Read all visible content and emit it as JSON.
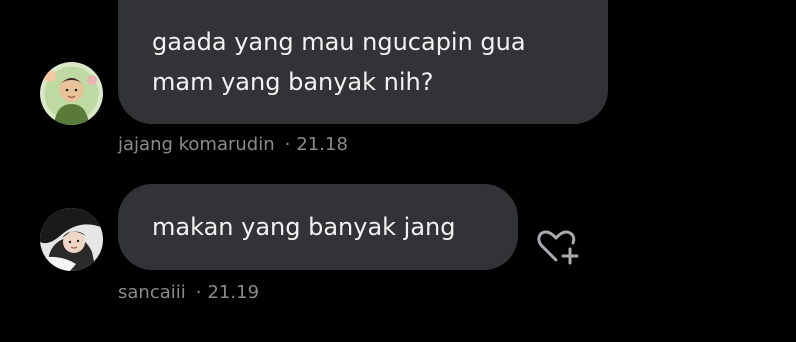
{
  "messages": [
    {
      "lines": [
        "gaada yang mau ngucapin gua",
        "mam yang banyak nih?"
      ],
      "author": "jajang komarudin",
      "time": "21.18",
      "avatar_icon": "profile-photo"
    },
    {
      "lines": [
        "makan yang banyak jang"
      ],
      "author": "sancaiii",
      "time": "21.19",
      "avatar_icon": "profile-photo"
    }
  ],
  "time_separator": "·",
  "like_icon": "heart-plus-icon",
  "colors": {
    "background": "#000000",
    "bubble": "#323336",
    "text": "#f2f2f2",
    "meta": "#8a8b8f"
  }
}
